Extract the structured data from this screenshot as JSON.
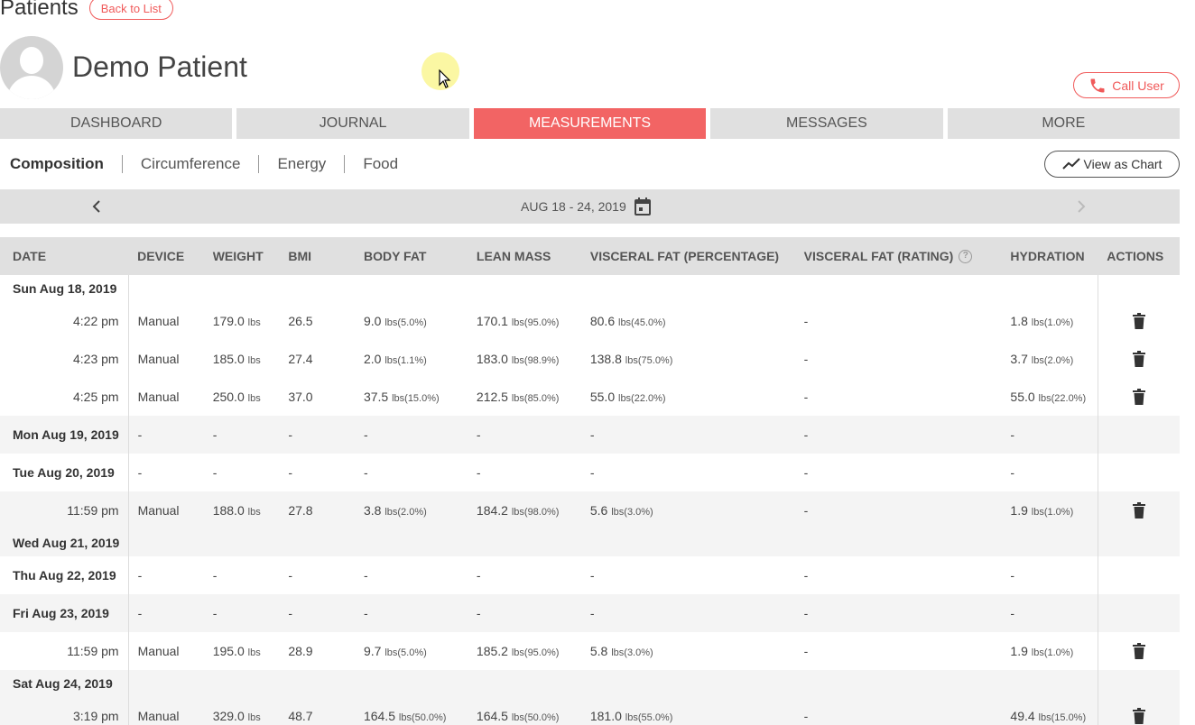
{
  "header": {
    "title": "Patients",
    "back_label": "Back to List",
    "patient_name": "Demo Patient",
    "call_label": "Call User"
  },
  "tabs": [
    {
      "label": "DASHBOARD",
      "active": false
    },
    {
      "label": "JOURNAL",
      "active": false
    },
    {
      "label": "MEASUREMENTS",
      "active": true
    },
    {
      "label": "MESSAGES",
      "active": false
    },
    {
      "label": "MORE",
      "active": false
    }
  ],
  "subtabs": [
    "Composition",
    "Circumference",
    "Energy",
    "Food"
  ],
  "chart_button_label": "View as Chart",
  "date_range": "AUG 18 - 24, 2019",
  "table": {
    "headers": [
      "DATE",
      "DEVICE",
      "WEIGHT",
      "BMI",
      "BODY FAT",
      "LEAN MASS",
      "VISCERAL FAT (PERCENTAGE)",
      "VISCERAL FAT (RATING)",
      "HYDRATION",
      "ACTIONS"
    ],
    "rows": [
      {
        "kind": "day",
        "date": "Sun Aug 18, 2019",
        "shade": false,
        "short": true,
        "empty": true
      },
      {
        "kind": "entry",
        "time": "4:22 pm",
        "device": "Manual",
        "weight": "179.0",
        "weight_unit": "lbs",
        "bmi": "26.5",
        "body_fat": "9.0",
        "body_fat_unit": "lbs(5.0%)",
        "lean_mass": "170.1",
        "lean_mass_unit": "lbs(95.0%)",
        "visceral_pct": "80.6",
        "visceral_pct_unit": "lbs(45.0%)",
        "visceral_rating": "-",
        "hydration": "1.8",
        "hydration_unit": "lbs(1.0%)",
        "shade": false
      },
      {
        "kind": "entry",
        "time": "4:23 pm",
        "device": "Manual",
        "weight": "185.0",
        "weight_unit": "lbs",
        "bmi": "27.4",
        "body_fat": "2.0",
        "body_fat_unit": "lbs(1.1%)",
        "lean_mass": "183.0",
        "lean_mass_unit": "lbs(98.9%)",
        "visceral_pct": "138.8",
        "visceral_pct_unit": "lbs(75.0%)",
        "visceral_rating": "-",
        "hydration": "3.7",
        "hydration_unit": "lbs(2.0%)",
        "shade": false
      },
      {
        "kind": "entry",
        "time": "4:25 pm",
        "device": "Manual",
        "weight": "250.0",
        "weight_unit": "lbs",
        "bmi": "37.0",
        "body_fat": "37.5",
        "body_fat_unit": "lbs(15.0%)",
        "lean_mass": "212.5",
        "lean_mass_unit": "lbs(85.0%)",
        "visceral_pct": "55.0",
        "visceral_pct_unit": "lbs(22.0%)",
        "visceral_rating": "-",
        "hydration": "55.0",
        "hydration_unit": "lbs(22.0%)",
        "shade": false
      },
      {
        "kind": "dayrow",
        "date": "Mon Aug 19, 2019",
        "shade": true
      },
      {
        "kind": "dayrow",
        "date": "Tue Aug 20, 2019",
        "shade": false
      },
      {
        "kind": "entry",
        "time": "11:59 pm",
        "device": "Manual",
        "weight": "188.0",
        "weight_unit": "lbs",
        "bmi": "27.8",
        "body_fat": "3.8",
        "body_fat_unit": "lbs(2.0%)",
        "lean_mass": "184.2",
        "lean_mass_unit": "lbs(98.0%)",
        "visceral_pct": "5.6",
        "visceral_pct_unit": "lbs(3.0%)",
        "visceral_rating": "-",
        "hydration": "1.9",
        "hydration_unit": "lbs(1.0%)",
        "shade": true
      },
      {
        "kind": "day",
        "date": "Wed Aug 21, 2019",
        "shade": true,
        "short": true,
        "empty": true
      },
      {
        "kind": "dayrow",
        "date": "Thu Aug 22, 2019",
        "shade": false
      },
      {
        "kind": "dayrow",
        "date": "Fri Aug 23, 2019",
        "shade": true
      },
      {
        "kind": "entry",
        "time": "11:59 pm",
        "device": "Manual",
        "weight": "195.0",
        "weight_unit": "lbs",
        "bmi": "28.9",
        "body_fat": "9.7",
        "body_fat_unit": "lbs(5.0%)",
        "lean_mass": "185.2",
        "lean_mass_unit": "lbs(95.0%)",
        "visceral_pct": "5.8",
        "visceral_pct_unit": "lbs(3.0%)",
        "visceral_rating": "-",
        "hydration": "1.9",
        "hydration_unit": "lbs(1.0%)",
        "shade": false
      },
      {
        "kind": "day",
        "date": "Sat Aug 24, 2019",
        "shade": true,
        "short": true,
        "empty": true
      },
      {
        "kind": "entry",
        "time": "3:19 pm",
        "device": "Manual",
        "weight": "329.0",
        "weight_unit": "lbs",
        "bmi": "48.7",
        "body_fat": "164.5",
        "body_fat_unit": "lbs(50.0%)",
        "lean_mass": "164.5",
        "lean_mass_unit": "lbs(50.0%)",
        "visceral_pct": "181.0",
        "visceral_pct_unit": "lbs(55.0%)",
        "visceral_rating": "-",
        "hydration": "49.4",
        "hydration_unit": "lbs(15.0%)",
        "shade": true
      }
    ],
    "dash": "-"
  },
  "colors": {
    "accent": "#f26464",
    "tab_bg": "#e0e0e0",
    "row_shade": "#f4f4f4"
  }
}
